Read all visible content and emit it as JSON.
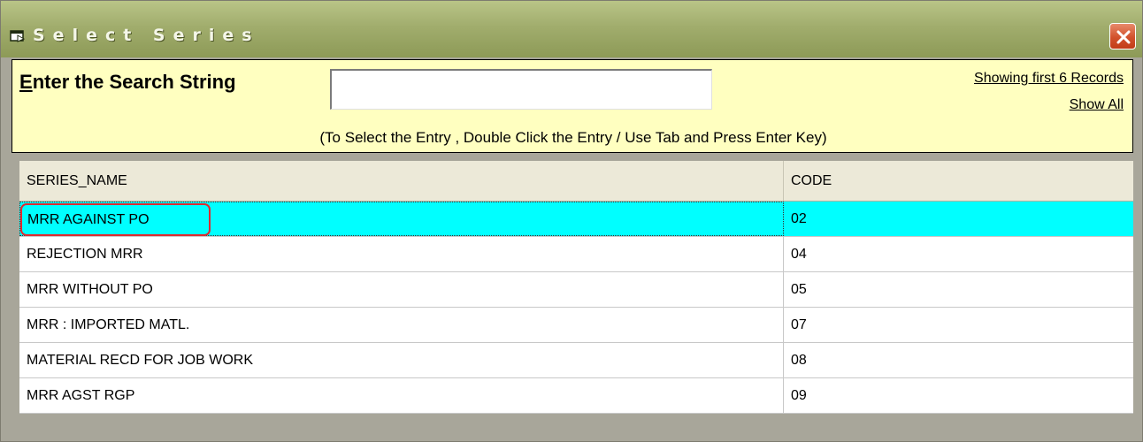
{
  "window": {
    "title": "Select Series",
    "close_icon": "close-icon",
    "title_icon": "window-app-icon"
  },
  "search": {
    "label_first": "E",
    "label_rest": "nter the Search String",
    "value": "",
    "records_link": "Showing first 6 Records",
    "show_all_link": "Show All",
    "hint": "(To Select the Entry , Double Click the Entry / Use Tab and Press Enter Key)"
  },
  "grid": {
    "columns": [
      "SERIES_NAME",
      "CODE"
    ],
    "rows": [
      {
        "series_name": "MRR AGAINST PO",
        "code": "02",
        "selected": true
      },
      {
        "series_name": "REJECTION MRR",
        "code": "04"
      },
      {
        "series_name": "MRR WITHOUT PO",
        "code": "05"
      },
      {
        "series_name": "MRR : IMPORTED MATL.",
        "code": "07"
      },
      {
        "series_name": "MATERIAL RECD FOR JOB WORK",
        "code": "08"
      },
      {
        "series_name": "MRR AGST RGP",
        "code": "09"
      }
    ]
  },
  "colors": {
    "selected_row": "#00ffff",
    "search_panel": "#ffffc0",
    "title_bar": "#a1ad6d",
    "close_button": "#d2512c"
  }
}
